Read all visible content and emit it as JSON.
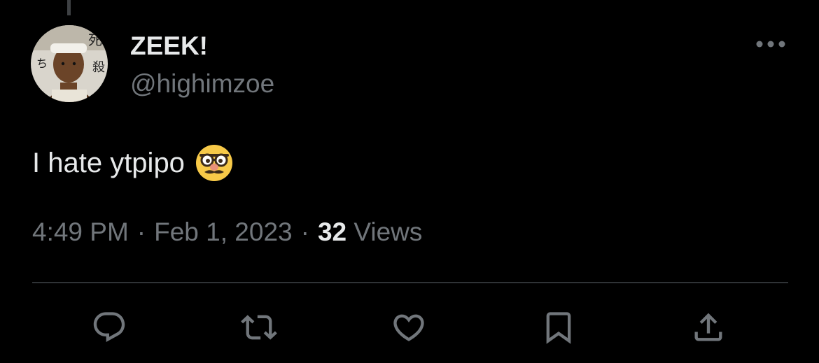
{
  "tweet": {
    "author": {
      "display_name": "ZEEK!",
      "handle": "@highimzoe",
      "avatar_icon": "profile-avatar"
    },
    "text": "I hate ytpipo",
    "emoji_icon": "disguised-face-icon",
    "meta": {
      "time": "4:49 PM",
      "separator": "·",
      "date": "Feb 1, 2023",
      "views_count": "32",
      "views_label": "Views"
    },
    "actions": [
      {
        "name": "reply",
        "icon": "reply-icon"
      },
      {
        "name": "retweet",
        "icon": "retweet-icon"
      },
      {
        "name": "like",
        "icon": "heart-icon"
      },
      {
        "name": "bookmark",
        "icon": "bookmark-icon"
      },
      {
        "name": "share",
        "icon": "share-icon"
      }
    ]
  },
  "colors": {
    "background": "#000000",
    "primary_text": "#e7e9ea",
    "secondary_text": "#71767b",
    "divider": "#2f3336"
  }
}
